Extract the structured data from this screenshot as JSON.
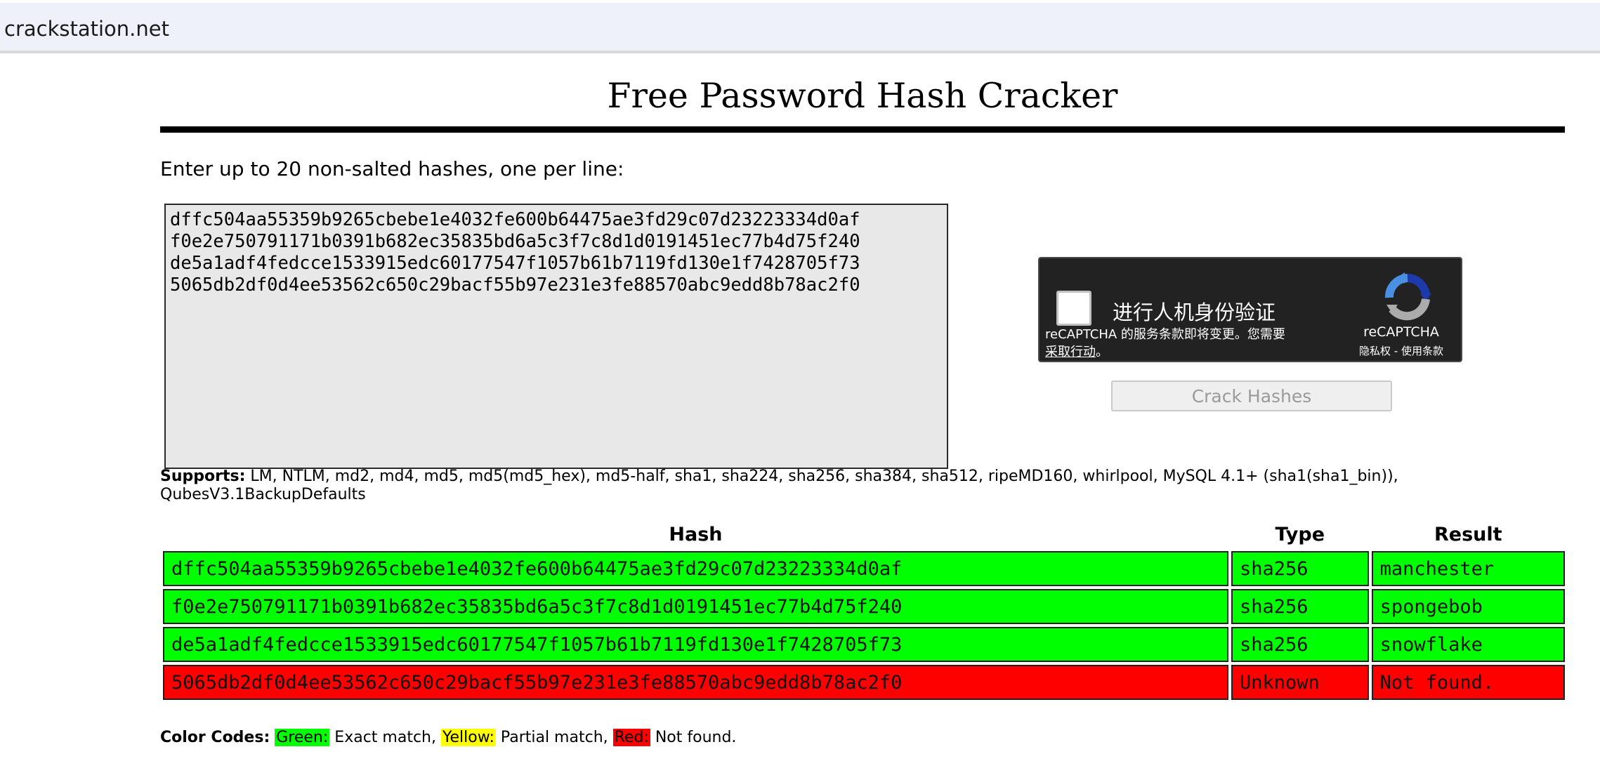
{
  "browser": {
    "url": "crackstation.net"
  },
  "page": {
    "title": "Free Password Hash Cracker",
    "instructions": "Enter up to 20 non-salted hashes, one per line:"
  },
  "hash_input": {
    "value": "dffc504aa55359b9265cbebe1e4032fe600b64475ae3fd29c07d23223334d0af\nf0e2e750791171b0391b682ec35835bd6a5c3f7c8d1d0191451ec77b4d75f240\nde5a1adf4fedcce1533915edc60177547f1057b61b7119fd130e1f7428705f73\n5065db2df0d4ee53562c650c29bacf55b97e231e3fe88570abc9edd8b78ac2f0"
  },
  "captcha": {
    "label": "进行人机身份验证",
    "terms_text": "reCAPTCHA 的服务条款即将变更。您需要",
    "terms_link": "采取行动",
    "terms_end": "。",
    "brand": "reCAPTCHA",
    "privacy_terms": "隐私权 - 使用条款",
    "logo_icon": "recaptcha-logo-icon"
  },
  "crack_button": {
    "label": "Crack Hashes"
  },
  "supports": {
    "label": "Supports:",
    "text": " LM, NTLM, md2, md4, md5, md5(md5_hex), md5-half, sha1, sha224, sha256, sha384, sha512, ripeMD160, whirlpool, MySQL 4.1+ (sha1(sha1_bin)), QubesV3.1BackupDefaults"
  },
  "results": {
    "headers": [
      "Hash",
      "Type",
      "Result"
    ],
    "rows": [
      {
        "hash": "dffc504aa55359b9265cbebe1e4032fe600b64475ae3fd29c07d23223334d0af",
        "type": "sha256",
        "result": "manchester",
        "status": "green"
      },
      {
        "hash": "f0e2e750791171b0391b682ec35835bd6a5c3f7c8d1d0191451ec77b4d75f240",
        "type": "sha256",
        "result": "spongebob",
        "status": "green"
      },
      {
        "hash": "de5a1adf4fedcce1533915edc60177547f1057b61b7119fd130e1f7428705f73",
        "type": "sha256",
        "result": "snowflake",
        "status": "green"
      },
      {
        "hash": "5065db2df0d4ee53562c650c29bacf55b97e231e3fe88570abc9edd8b78ac2f0",
        "type": "Unknown",
        "result": "Not found.",
        "status": "red"
      }
    ]
  },
  "color_codes": {
    "label": "Color Codes:",
    "green_label": "Green:",
    "green_text": " Exact match, ",
    "yellow_label": "Yellow:",
    "yellow_text": " Partial match, ",
    "red_label": "Red:",
    "red_text": " Not found."
  },
  "colors": {
    "exact_match": "#00ff00",
    "partial_match": "#ffff00",
    "not_found": "#ff0000"
  }
}
